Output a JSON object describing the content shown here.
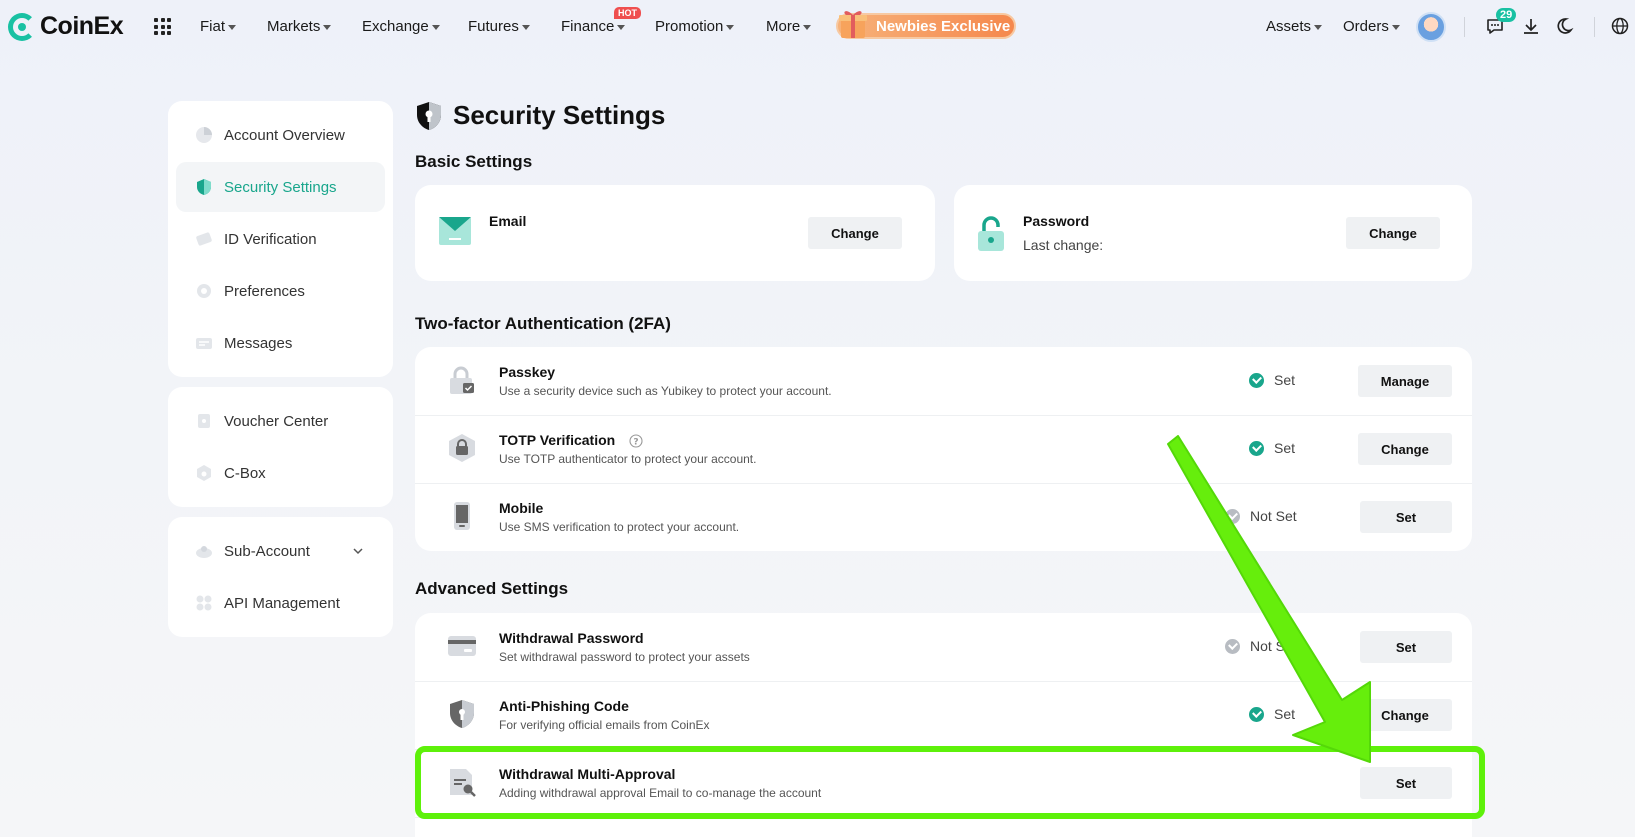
{
  "brand": {
    "name": "CoinEx",
    "accent": "#19c1a3"
  },
  "nav": {
    "items": [
      "Fiat",
      "Markets",
      "Exchange",
      "Futures",
      "Finance",
      "Promotion",
      "More"
    ],
    "hot_badge": "HOT",
    "promo": "Newbies Exclusive",
    "right": [
      "Assets",
      "Orders"
    ],
    "notifications": "29"
  },
  "sidebar": {
    "group1": [
      "Account Overview",
      "Security Settings",
      "ID Verification",
      "Preferences",
      "Messages"
    ],
    "group2": [
      "Voucher Center",
      "C-Box"
    ],
    "group3": [
      "Sub-Account",
      "API Management"
    ]
  },
  "page": {
    "title": "Security Settings"
  },
  "basic": {
    "heading": "Basic Settings",
    "email": {
      "title": "Email",
      "button": "Change"
    },
    "password": {
      "title": "Password",
      "subtitle": "Last change:",
      "button": "Change"
    }
  },
  "twofa": {
    "heading": "Two-factor Authentication (2FA)",
    "rows": [
      {
        "title": "Passkey",
        "desc": "Use a security device such as Yubikey to protect your account.",
        "status": "Set",
        "button": "Manage"
      },
      {
        "title": "TOTP Verification",
        "desc": "Use TOTP authenticator to protect your account.",
        "status": "Set",
        "button": "Change"
      },
      {
        "title": "Mobile",
        "desc": "Use SMS verification to protect your account.",
        "status": "Not Set",
        "button": "Set"
      }
    ]
  },
  "advanced": {
    "heading": "Advanced Settings",
    "rows": [
      {
        "title": "Withdrawal Password",
        "desc": "Set withdrawal password to protect your assets",
        "status": "Not Set",
        "button": "Set"
      },
      {
        "title": "Anti-Phishing Code",
        "desc": "For verifying official emails from CoinEx",
        "status": "Set",
        "button": "Change"
      },
      {
        "title": "Withdrawal Multi-Approval",
        "desc": "Adding withdrawal approval Email to co-manage the account",
        "button": "Set"
      }
    ]
  },
  "colors": {
    "highlight": "#5ef10a",
    "arrow": "#66ee0c",
    "set_check": "#19a68c"
  }
}
